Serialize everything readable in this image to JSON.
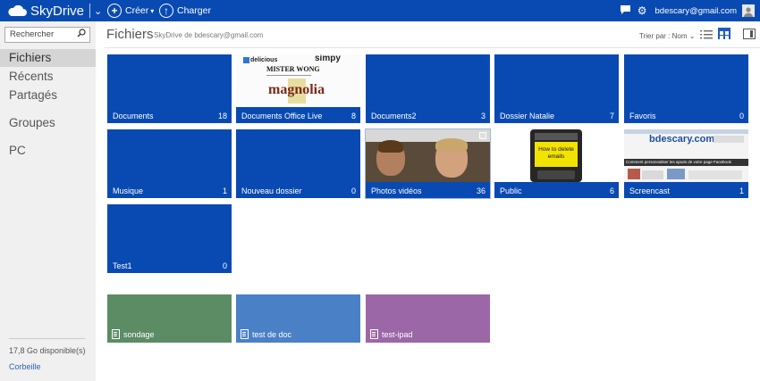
{
  "colors": {
    "topbar": "#094ab2",
    "folder_tile": "#094ab2",
    "sondage": "#5b8c64",
    "test_de_doc": "#4a80c6",
    "test_ipad": "#9b67a6",
    "sidebar": "#f0f0f0",
    "link": "#2a62b9"
  },
  "topbar": {
    "brand": "SkyDrive",
    "create_label": "Créer",
    "upload_label": "Charger",
    "user_email": "bdescary@gmail.com",
    "icons": [
      "skydrive-cloud-icon",
      "chevron-down-icon",
      "plus-circle-icon",
      "upload-circle-icon",
      "chat-icon",
      "gear-icon",
      "avatar-icon"
    ]
  },
  "sidebar": {
    "search_placeholder": "Rechercher",
    "items": [
      {
        "label": "Fichiers",
        "active": true
      },
      {
        "label": "Récents"
      },
      {
        "label": "Partagés"
      },
      {
        "label": "Groupes"
      },
      {
        "label": "PC"
      }
    ],
    "storage": "17,8 Go disponible(s)",
    "trash": "Corbeille"
  },
  "header": {
    "title": "Fichiers",
    "subtitle": "SkyDrive de bdescary@gmail.com",
    "sort_label": "Trier par : Nom",
    "icons": [
      "list-view-icon",
      "thumbnail-view-icon",
      "details-pane-icon"
    ]
  },
  "folders": [
    {
      "name": "Documents",
      "count": "18"
    },
    {
      "name": "Documents Office Live",
      "count": "8",
      "thumb_texts": [
        "delicious",
        "simpy",
        "MISTER WONG",
        "magnolia"
      ]
    },
    {
      "name": "Documents2",
      "count": "3"
    },
    {
      "name": "Dossier Natalie",
      "count": "7"
    },
    {
      "name": "Favoris",
      "count": "0"
    },
    {
      "name": "Musique",
      "count": "1"
    },
    {
      "name": "Nouveau dossier",
      "count": "0"
    },
    {
      "name": "Photos vidéos",
      "count": "36"
    },
    {
      "name": "Public",
      "count": "6",
      "thumb_texts": [
        "How to delete emails"
      ]
    },
    {
      "name": "Screencast",
      "count": "1",
      "thumb_texts": [
        "bdescary.com",
        "Comment personnaliser les ajouts de votre page Facebook"
      ]
    },
    {
      "name": "Test1",
      "count": "0"
    }
  ],
  "documents": [
    {
      "name": "sondage",
      "color": "#5b8c64"
    },
    {
      "name": "test de doc",
      "color": "#4a80c6"
    },
    {
      "name": "test-ipad",
      "color": "#9b67a6"
    }
  ]
}
